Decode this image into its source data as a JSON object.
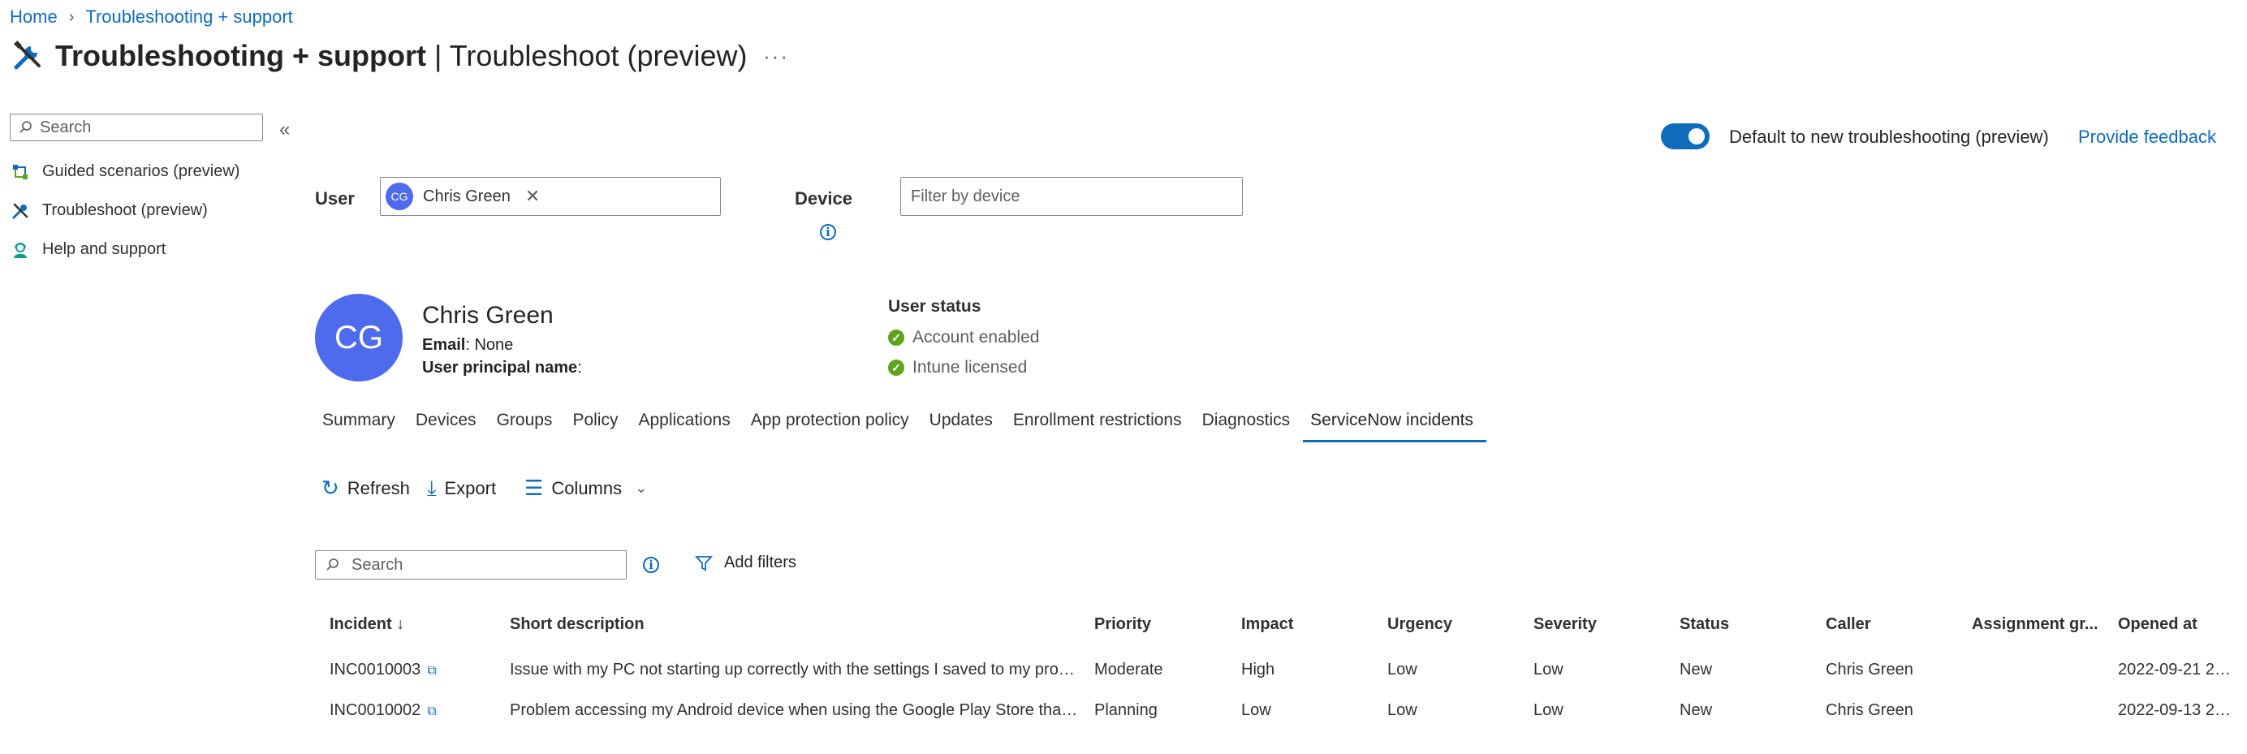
{
  "breadcrumb": {
    "home": "Home",
    "current": "Troubleshooting + support"
  },
  "page": {
    "title_bold": "Troubleshooting + support",
    "title_rest": " | Troubleshoot (preview)",
    "more": "···"
  },
  "sidebar": {
    "search_placeholder": "Search",
    "collapse": "«",
    "items": [
      {
        "label": "Guided scenarios (preview)",
        "icon": "scenarios-icon"
      },
      {
        "label": "Troubleshoot (preview)",
        "icon": "tools-icon"
      },
      {
        "label": "Help and support",
        "icon": "support-icon"
      }
    ]
  },
  "header": {
    "toggle_label": "Default to new troubleshooting (preview)",
    "toggle_on": true,
    "feedback": "Provide feedback"
  },
  "filters": {
    "user_label": "User",
    "user_chip_initials": "CG",
    "user_chip_name": "Chris Green",
    "device_label": "Device",
    "device_placeholder": "Filter by device"
  },
  "profile": {
    "initials": "CG",
    "name": "Chris Green",
    "email_label": "Email",
    "email_value": ": None",
    "upn_label": "User principal name",
    "upn_value": ":",
    "status_heading": "User status",
    "statuses": [
      "Account enabled",
      "Intune licensed"
    ]
  },
  "tabs": [
    "Summary",
    "Devices",
    "Groups",
    "Policy",
    "Applications",
    "App protection policy",
    "Updates",
    "Enrollment restrictions",
    "Diagnostics",
    "ServiceNow incidents"
  ],
  "active_tab": "ServiceNow incidents",
  "toolbar": {
    "refresh": "Refresh",
    "export": "Export",
    "columns": "Columns"
  },
  "table_search_placeholder": "Search",
  "add_filters": "Add filters",
  "table": {
    "columns": [
      "Incident ↓",
      "Short description",
      "Priority",
      "Impact",
      "Urgency",
      "Severity",
      "Status",
      "Caller",
      "Assignment gr...",
      "Opened at"
    ],
    "rows": [
      [
        "INC0010003",
        "Issue with my PC not starting up correctly with the settings I saved to my profil...",
        "Moderate",
        "High",
        "Low",
        "Low",
        "New",
        "Chris Green",
        "",
        "2022-09-21 21:..."
      ],
      [
        "INC0010002",
        "Problem accessing my Android device when using the Google Play Store that's...",
        "Planning",
        "Low",
        "Low",
        "Low",
        "New",
        "Chris Green",
        "",
        "2022-09-13 22:..."
      ]
    ]
  },
  "colors": {
    "accent": "#0f6cbd",
    "avatar": "#4f6bed",
    "ok": "#5ea51d"
  }
}
